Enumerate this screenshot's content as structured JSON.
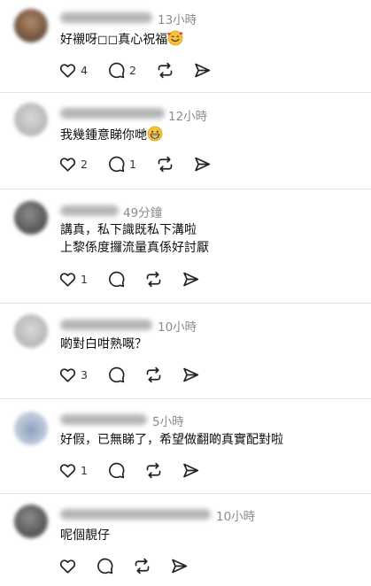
{
  "comments": [
    {
      "time": "13小時",
      "lines": [
        "好襯呀◻◻真心祝福"
      ],
      "emoji": "smiling-face-with-hearts",
      "likes": "4",
      "replies": "2",
      "reposts": "",
      "shares": ""
    },
    {
      "time": "12小時",
      "lines": [
        "我幾鍾意睇你哋"
      ],
      "emoji": "grinning-face",
      "likes": "2",
      "replies": "1",
      "reposts": "",
      "shares": ""
    },
    {
      "time": "49分鐘",
      "lines": [
        "講真，私下識既私下溝啦",
        "上黎係度攞流量真係好討厭"
      ],
      "emoji": "",
      "likes": "1",
      "replies": "",
      "reposts": "",
      "shares": ""
    },
    {
      "time": "10小時",
      "lines": [
        "啲對白咁熟嘅？"
      ],
      "emoji": "",
      "likes": "3",
      "replies": "",
      "reposts": "",
      "shares": ""
    },
    {
      "time": "5小時",
      "lines": [
        "好假，已無睇了，希望做翻啲真實配對啦"
      ],
      "emoji": "",
      "likes": "1",
      "replies": "",
      "reposts": "",
      "shares": ""
    },
    {
      "time": "10小時",
      "lines": [
        "呢個靚仔"
      ],
      "emoji": "",
      "likes": "",
      "replies": "",
      "reposts": "",
      "shares": ""
    }
  ],
  "icons": {
    "like": "heart-icon",
    "reply": "speech-bubble-icon",
    "repost": "repost-icon",
    "share": "send-icon"
  },
  "colors": {
    "text": "#101010",
    "meta": "#8a8a8a",
    "divider": "#e4e4e4",
    "icon": "#222222",
    "emoji_face": "#f5c33b"
  }
}
